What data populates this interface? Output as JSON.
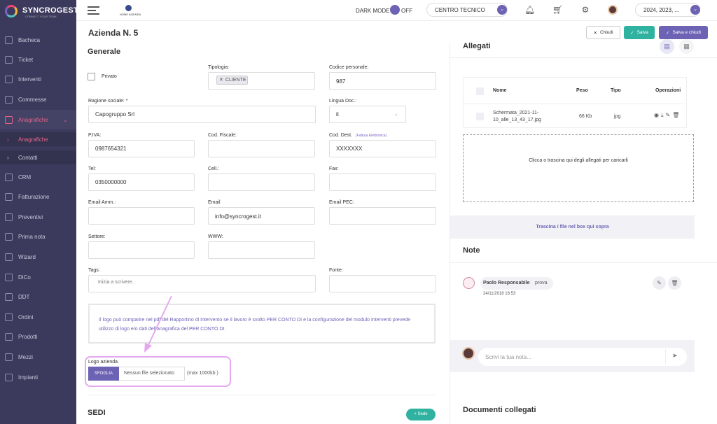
{
  "app": {
    "name": "SYNCROGEST",
    "tagline": "CONNECT YOUR TEAM",
    "company_logo_text": "NOME AZIENDA"
  },
  "sidebar": {
    "items": [
      {
        "label": "Bacheca",
        "icon": "dashboard-icon"
      },
      {
        "label": "Ticket",
        "icon": "ticket-icon"
      },
      {
        "label": "Interventi",
        "icon": "tools-icon"
      },
      {
        "label": "Commesse",
        "icon": "folder-icon"
      },
      {
        "label": "Anagrafiche",
        "icon": "address-book-icon",
        "active": true
      },
      {
        "label": "CRM",
        "icon": "crm-icon"
      },
      {
        "label": "Fatturazione",
        "icon": "invoice-icon"
      },
      {
        "label": "Preventivi",
        "icon": "quote-icon"
      },
      {
        "label": "Prima nota",
        "icon": "ledger-icon"
      },
      {
        "label": "Wizard",
        "icon": "wizard-icon"
      },
      {
        "label": "DiCo",
        "icon": "dico-icon"
      },
      {
        "label": "DDT",
        "icon": "ddt-icon"
      },
      {
        "label": "Ordini",
        "icon": "cart-icon"
      },
      {
        "label": "Prodotti",
        "icon": "box-icon"
      },
      {
        "label": "Mezzi",
        "icon": "truck-icon"
      },
      {
        "label": "Impianti",
        "icon": "plant-icon"
      }
    ],
    "subitems": [
      {
        "label": "Anagrafiche",
        "active": true
      },
      {
        "label": "Contatti",
        "active": false
      }
    ]
  },
  "topbar": {
    "dark_mode_label": "DARK MODE",
    "dark_mode_state": "OFF",
    "centro_label": "CENTRO TECNICO",
    "years_label": "2024, 2023, ..."
  },
  "header": {
    "title": "Azienda N. 5",
    "chiudi": "Chiudi",
    "salva": "Salva",
    "salva_chiudi": "Salva e chiudi"
  },
  "form": {
    "section_title": "Generale",
    "privato_label": "Privato",
    "tipologia_label": "Tipologia:",
    "tipologia_tag": "CLIENTE",
    "codice_personale_label": "Codice personale:",
    "codice_personale_value": "987",
    "ragione_sociale_label": "Ragione sociale: *",
    "ragione_sociale_value": "Capogruppo Srl",
    "lingua_label": "Lingua Doc.:",
    "lingua_value": "it",
    "piva_label": "P.IVA:",
    "piva_value": "0987654321",
    "codfiscale_label": "Cod. Fiscale:",
    "coddest_label": "Cod. Dest.",
    "coddest_note": "(Fattura Elettronica)",
    "coddest_value": "XXXXXXX",
    "tel_label": "Tel:",
    "tel_value": "0350000000",
    "cell_label": "Cell.:",
    "fax_label": "Fax:",
    "email_amm_label": "Email Amm.:",
    "email_label": "Email",
    "email_value": "info@syncrogest.it",
    "email_pec_label": "Email PEC:",
    "settore_label": "Settore:",
    "www_label": "WWW:",
    "tags_label": "Tags:",
    "tags_placeholder": "Inizia a scrivere..",
    "fonte_label": "Fonte:",
    "info_text": "Il logo può comparire nel pdf del Rapportino di Intervento se il lavoro è svolto PER CONTO DI e la configurazione del modulo Interventi prevede utilizzo di logo e/o dati dell'anagrafica del PER CONTO DI.",
    "logo_label": "Logo azienda",
    "sfoglia": "SFOGLIA",
    "file_placeholder": "Nessun file selezionato",
    "file_max": "(max 1000kb )",
    "sedi_title": "SEDI",
    "sede_button": "Sede"
  },
  "allegati": {
    "title": "Allegati",
    "headers": {
      "nome": "Nome",
      "peso": "Peso",
      "tipo": "Tipo",
      "operazioni": "Operazioni"
    },
    "rows": [
      {
        "nome": "Schermata_2021-11-10_alle_13_43_17.jpg",
        "peso": "66 Kb",
        "tipo": "jpg"
      }
    ],
    "dropzone_text": "Clicca o trascina qui degli allegati per caricarli",
    "trascina_text": "Trascina i file nel box qui sopra"
  },
  "note": {
    "title": "Note",
    "items": [
      {
        "author": "Paolo Responsabile",
        "text": "prova",
        "date": "24/11/2018 16:53"
      }
    ],
    "composer_placeholder": "Scrivi la tua nota..."
  },
  "documenti": {
    "title": "Documenti collegati"
  },
  "colors": {
    "sidebar": "#3b3a5c",
    "accent": "#6c63b5",
    "teal": "#2fb3a0",
    "active": "#e2648a",
    "highlight": "#e5a8f0"
  }
}
